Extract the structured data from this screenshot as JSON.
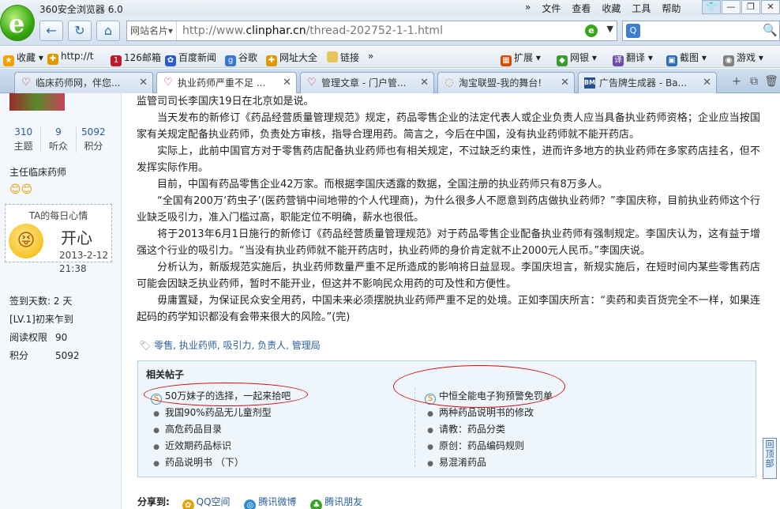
{
  "browser": {
    "title": "360安全浏览器 6.0",
    "menu": [
      "文件",
      "查看",
      "收藏",
      "工具",
      "帮助"
    ],
    "menu_more": "»",
    "window_buttons": [
      "👕",
      "—",
      "❐",
      "✕"
    ],
    "logo_letter": "e"
  },
  "nav": {
    "back": "←",
    "refresh": "↻",
    "home": "⌂",
    "address_tag": "网站名片▾",
    "url_prefix": "http://www.",
    "url_host": "clinphar.cn",
    "url_path": "/thread-202752-1-1.html",
    "engine_icon": "Q",
    "search_go": "🔍"
  },
  "favorites": [
    {
      "label": "收藏 ▾",
      "icon": "",
      "color": "#f5a000"
    },
    {
      "label": "http://t",
      "icon": "✚",
      "color": "#e09a00"
    },
    {
      "label": "126邮箱",
      "icon": "1",
      "color": "#c0192b"
    },
    {
      "label": "百度新闻",
      "icon": "✿",
      "color": "#2a5ad0"
    },
    {
      "label": "谷歌",
      "icon": "g",
      "color": "#3b78d6"
    },
    {
      "label": "网址大全",
      "icon": "✚",
      "color": "#e09a00"
    },
    {
      "label": "链接",
      "icon": "",
      "color": "#e8c45a"
    },
    {
      "label": "»",
      "icon": "",
      "color": ""
    }
  ],
  "fav_right": [
    {
      "label": "扩展 ▾",
      "icon": "▦",
      "color": "#d44a00"
    },
    {
      "label": "网银 ▾",
      "icon": "◆",
      "color": "#3a9b2f"
    },
    {
      "label": "翻译 ▾",
      "icon": "译",
      "color": "#6b4aa8"
    },
    {
      "label": "截图 ▾",
      "icon": "▣",
      "color": "#2a6bb5"
    },
    {
      "label": "游戏 ▾",
      "icon": "◉",
      "color": "#7f7f7f"
    }
  ],
  "tabs": [
    {
      "label": "临床药师网，伴您...",
      "icon": "♡",
      "active": false
    },
    {
      "label": "执业药师严重不足 ...",
      "icon": "♡",
      "active": true
    },
    {
      "label": "管理文章 - 门户管...",
      "icon": "♡",
      "active": false
    },
    {
      "label": "淘宝联盟-我的舞台!",
      "icon": "◌",
      "active": false
    },
    {
      "label": "广告牌生成器 - Ba...",
      "icon": "BM",
      "active": false
    }
  ],
  "tab_tools": [
    "+",
    "⧉",
    "🗑"
  ],
  "sidebar": {
    "stats": [
      {
        "num": "310",
        "label": "主题"
      },
      {
        "num": "9",
        "label": "听众"
      },
      {
        "num": "5092",
        "label": "积分"
      }
    ],
    "rank": "主任临床药师",
    "smileys": "😊😊",
    "mood": {
      "title": "TA的每日心情",
      "face": "😝",
      "word": "开心",
      "date": "2013-2-12",
      "time": "21:38"
    },
    "info": [
      {
        "k": "签到天数:",
        "v": "2 天"
      },
      {
        "k": "[LV.1]初来乍到",
        "v": ""
      },
      {
        "k": "阅读权限",
        "v": "90"
      },
      {
        "k": "积分",
        "v": "5092"
      }
    ]
  },
  "article": {
    "paragraphs": [
      "监管司司长李国庆19日在北京如是说。",
      "当天发布的新修订《药品经营质量管理规范》规定，药品零售企业的法定代表人或企业负责人应当具备执业药师资格；企业应当按国家有关规定配备执业药师，负责处方审核，指导合理用药。简言之，今后在中国，没有执业药师就不能开药店。",
      "实际上，此前中国官方对于零售药店配备执业药师也有相关规定，不过缺乏约束性，进而许多地方的执业药师在多家药店挂名，但不发挥实际作用。",
      "目前，中国有药品零售企业42万家。而根据李国庆透露的数据，全国注册的执业药师只有8万多人。",
      "“全国有200万‘药虫子’(医药营销中间地带的个人代理商)，为什么很多人不愿意到药店做执业药师？”李国庆称，目前执业药师这个行业缺乏吸引力，准入门槛过高，职能定位不明确，薪水也很低。",
      "将于2013年6月1日施行的新修订《药品经营质量管理规范》对于药品零售企业配备执业药师有强制规定。李国庆认为，这有益于增强这个行业的吸引力。“当没有执业药师就不能开药店时，执业药师的身价肯定就不止2000元人民币。”李国庆说。",
      "分析认为，新版规范实施后，执业药师数量严重不足所造成的影响将日益显现。李国庆坦言，新规实施后，在短时间内某些零售药店可能会因缺乏执业药师，暂时不能开业，但这并不影响民众用药的可及性和方便性。",
      "毋庸置疑，为保证民众安全用药，中国未来必须摆脱执业药师严重不足的处境。正如李国庆所言：“卖药和卖百货完全不一样，如果连起码的药学知识都没有会带来很大的风险。”(完)"
    ],
    "tags_icon": "🏷",
    "tags": "零售, 执业药师, 吸引力, 负责人, 管理局"
  },
  "related": {
    "title": "相关帖子",
    "left": [
      {
        "label": "50万妹子的选择，一起来拾吧",
        "ad": true
      },
      {
        "label": "我国90%药品无儿童剂型",
        "ad": false
      },
      {
        "label": "高危药品目录",
        "ad": false
      },
      {
        "label": "近效期药品标识",
        "ad": false
      },
      {
        "label": "药品说明书 （下）",
        "ad": false
      }
    ],
    "right": [
      {
        "label": "中恒全能电子狗预警免罚单",
        "ad": true
      },
      {
        "label": "两种药品说明书的修改",
        "ad": false
      },
      {
        "label": "请教：药品分类",
        "ad": false
      },
      {
        "label": "原创：药品编码规则",
        "ad": false
      },
      {
        "label": "易混淆药品",
        "ad": false
      }
    ],
    "ad_icon": "S",
    "bullet": "●"
  },
  "share": {
    "label": "分享到:",
    "targets": [
      {
        "label": "QQ空间",
        "icon": "✿",
        "color": "#e6a300"
      },
      {
        "label": "腾讯微博",
        "icon": "◎",
        "color": "#2a8ad6"
      },
      {
        "label": "腾讯朋友",
        "icon": "♣",
        "color": "#3aa02a"
      }
    ]
  },
  "back_to_top": "回顶部"
}
